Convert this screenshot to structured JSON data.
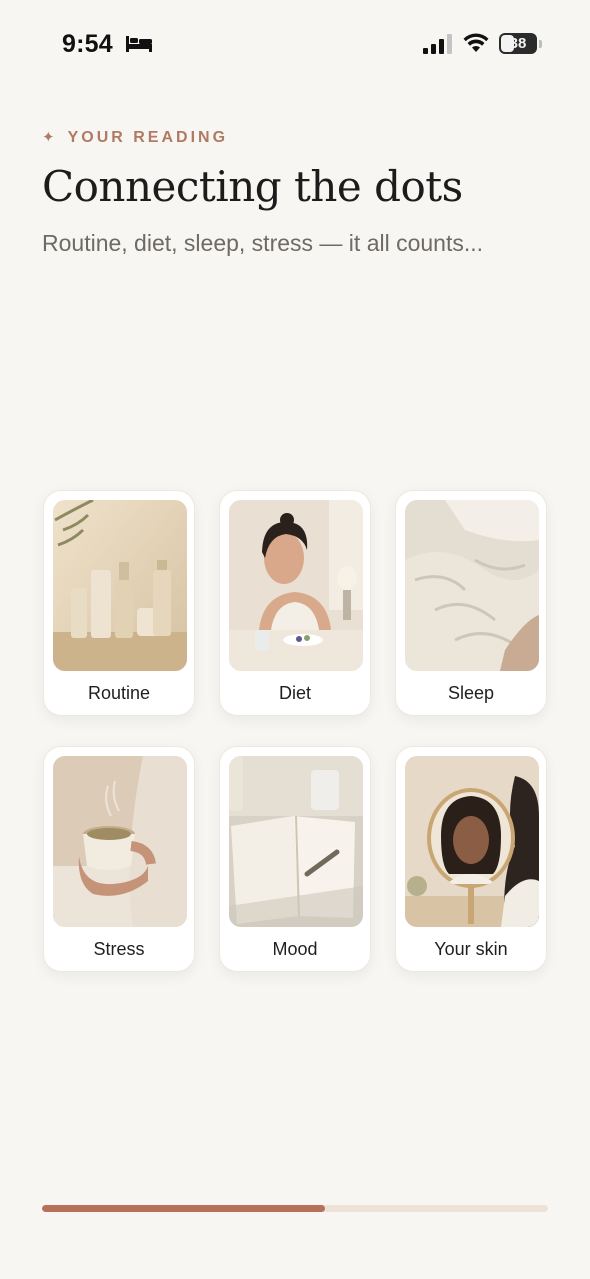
{
  "status_bar": {
    "time": "9:54",
    "battery": "38",
    "battery_level": 0.38,
    "icons": [
      "bed-icon",
      "signal-icon",
      "wifi-icon",
      "battery-icon"
    ]
  },
  "header": {
    "eyebrow_icon": "✦",
    "eyebrow": "YOUR READING",
    "title": "Connecting the dots",
    "subtitle": "Routine, diet, sleep, stress — it all counts..."
  },
  "cards": [
    {
      "label": "Routine",
      "image": "skincare-products-photo"
    },
    {
      "label": "Diet",
      "image": "woman-breakfast-photo"
    },
    {
      "label": "Sleep",
      "image": "bed-linen-photo"
    },
    {
      "label": "Stress",
      "image": "hands-holding-tea-photo"
    },
    {
      "label": "Mood",
      "image": "journal-notebook-photo"
    },
    {
      "label": "Your skin",
      "image": "woman-mirror-photo"
    }
  ],
  "progress": {
    "value": 0.56
  },
  "colors": {
    "background": "#f8f6f2",
    "accent": "#b07a63",
    "progress_fill": "#b5715a",
    "progress_track": "#ece2d8"
  }
}
